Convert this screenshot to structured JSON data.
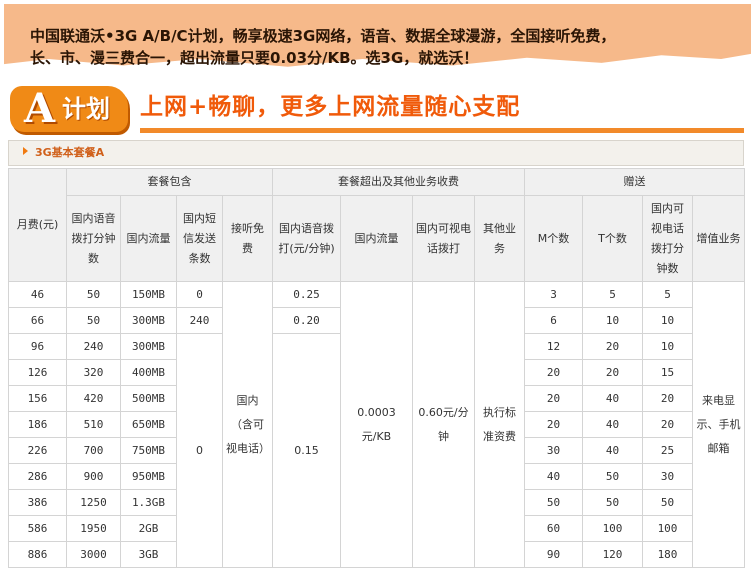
{
  "banner": {
    "line1": "中国联通沃•3G A/B/C计划，畅享极速3G网络，语音、数据全球漫游，全国接听免费，",
    "line2": "长、市、漫三费合一，超出流量只要0.03分/KB。选3G，就选沃！"
  },
  "plan_header": {
    "logo_letter": "A",
    "logo_word": "计划",
    "headline": "上网+畅聊，更多上网流量随心支配"
  },
  "section": {
    "title": "3G基本套餐A"
  },
  "colors": {
    "banner_bg": "#f6b98a",
    "accent_orange": "#f05a0a",
    "logo_orange": "#f08a16",
    "header_cell_bg": "#f0f0f0"
  },
  "table": {
    "group_headers": {
      "monthly_fee": "月费(元)",
      "included": "套餐包含",
      "overage": "套餐超出及其他业务收费",
      "gift": "赠送"
    },
    "sub_headers": {
      "voice_minutes": "国内语音拨打分钟数",
      "data": "国内流量",
      "sms": "国内短信发送条数",
      "receive_free": "接听免费",
      "voice_rate": "国内语音拨打(元/分钟)",
      "data_rate": "国内流量",
      "video_call": "国内可视电话拨打",
      "other": "其他业务",
      "m_count": "M个数",
      "t_count": "T个数",
      "video_minutes": "国内可视电话拨打分钟数",
      "value_added": "增值业务"
    },
    "rows": [
      {
        "fee": "46",
        "voice": "50",
        "data": "150MB",
        "m": "3",
        "t": "5",
        "video": "5"
      },
      {
        "fee": "66",
        "voice": "50",
        "data": "300MB",
        "m": "6",
        "t": "10",
        "video": "10"
      },
      {
        "fee": "96",
        "voice": "240",
        "data": "300MB",
        "m": "12",
        "t": "20",
        "video": "10"
      },
      {
        "fee": "126",
        "voice": "320",
        "data": "400MB",
        "m": "20",
        "t": "20",
        "video": "15"
      },
      {
        "fee": "156",
        "voice": "420",
        "data": "500MB",
        "m": "20",
        "t": "40",
        "video": "20"
      },
      {
        "fee": "186",
        "voice": "510",
        "data": "650MB",
        "m": "20",
        "t": "40",
        "video": "20"
      },
      {
        "fee": "226",
        "voice": "700",
        "data": "750MB",
        "m": "30",
        "t": "40",
        "video": "25"
      },
      {
        "fee": "286",
        "voice": "900",
        "data": "950MB",
        "m": "40",
        "t": "50",
        "video": "30"
      },
      {
        "fee": "386",
        "voice": "1250",
        "data": "1.3GB",
        "m": "50",
        "t": "50",
        "video": "50"
      },
      {
        "fee": "586",
        "voice": "1950",
        "data": "2GB",
        "m": "60",
        "t": "100",
        "video": "100"
      },
      {
        "fee": "886",
        "voice": "3000",
        "data": "3GB",
        "m": "90",
        "t": "120",
        "video": "180"
      }
    ],
    "merged": {
      "sms_46": "0",
      "sms_66": "240",
      "sms_rest": "0",
      "receive_free": "国内（含可视电话）",
      "voice_rate_46": "0.25",
      "voice_rate_66": "0.20",
      "voice_rate_rest": "0.15",
      "data_rate": "0.0003元/KB",
      "video_call_rate": "0.60元/分钟",
      "other": "执行标准资费",
      "value_added": "来电显示、手机邮箱"
    }
  }
}
